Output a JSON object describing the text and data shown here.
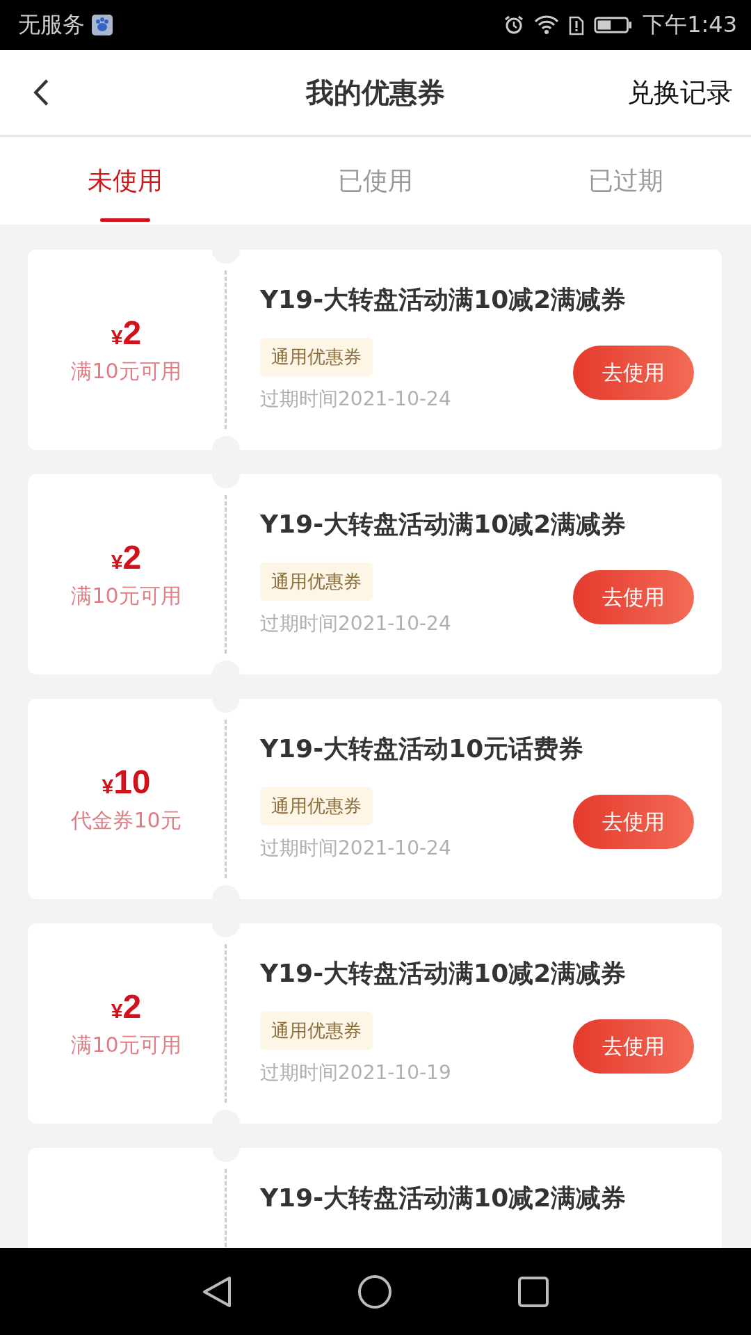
{
  "status_bar": {
    "carrier": "无服务",
    "time": "下午1:43"
  },
  "header": {
    "title": "我的优惠券",
    "action": "兑换记录"
  },
  "tabs": [
    {
      "label": "未使用",
      "selected": true
    },
    {
      "label": "已使用",
      "selected": false
    },
    {
      "label": "已过期",
      "selected": false
    }
  ],
  "coupons": [
    {
      "currency": "¥",
      "amount": "2",
      "condition": "满10元可用",
      "title": "Y19-大转盘活动满10减2满减券",
      "tag": "通用优惠券",
      "expiry": "过期时间2021-10-24",
      "button": "去使用"
    },
    {
      "currency": "¥",
      "amount": "2",
      "condition": "满10元可用",
      "title": "Y19-大转盘活动满10减2满减券",
      "tag": "通用优惠券",
      "expiry": "过期时间2021-10-24",
      "button": "去使用"
    },
    {
      "currency": "¥",
      "amount": "10",
      "condition": "代金券10元",
      "title": "Y19-大转盘活动10元话费券",
      "tag": "通用优惠券",
      "expiry": "过期时间2021-10-24",
      "button": "去使用"
    },
    {
      "currency": "¥",
      "amount": "2",
      "condition": "满10元可用",
      "title": "Y19-大转盘活动满10减2满减券",
      "tag": "通用优惠券",
      "expiry": "过期时间2021-10-19",
      "button": "去使用"
    },
    {
      "title": "Y19-大转盘活动满10减2满减券"
    }
  ]
}
